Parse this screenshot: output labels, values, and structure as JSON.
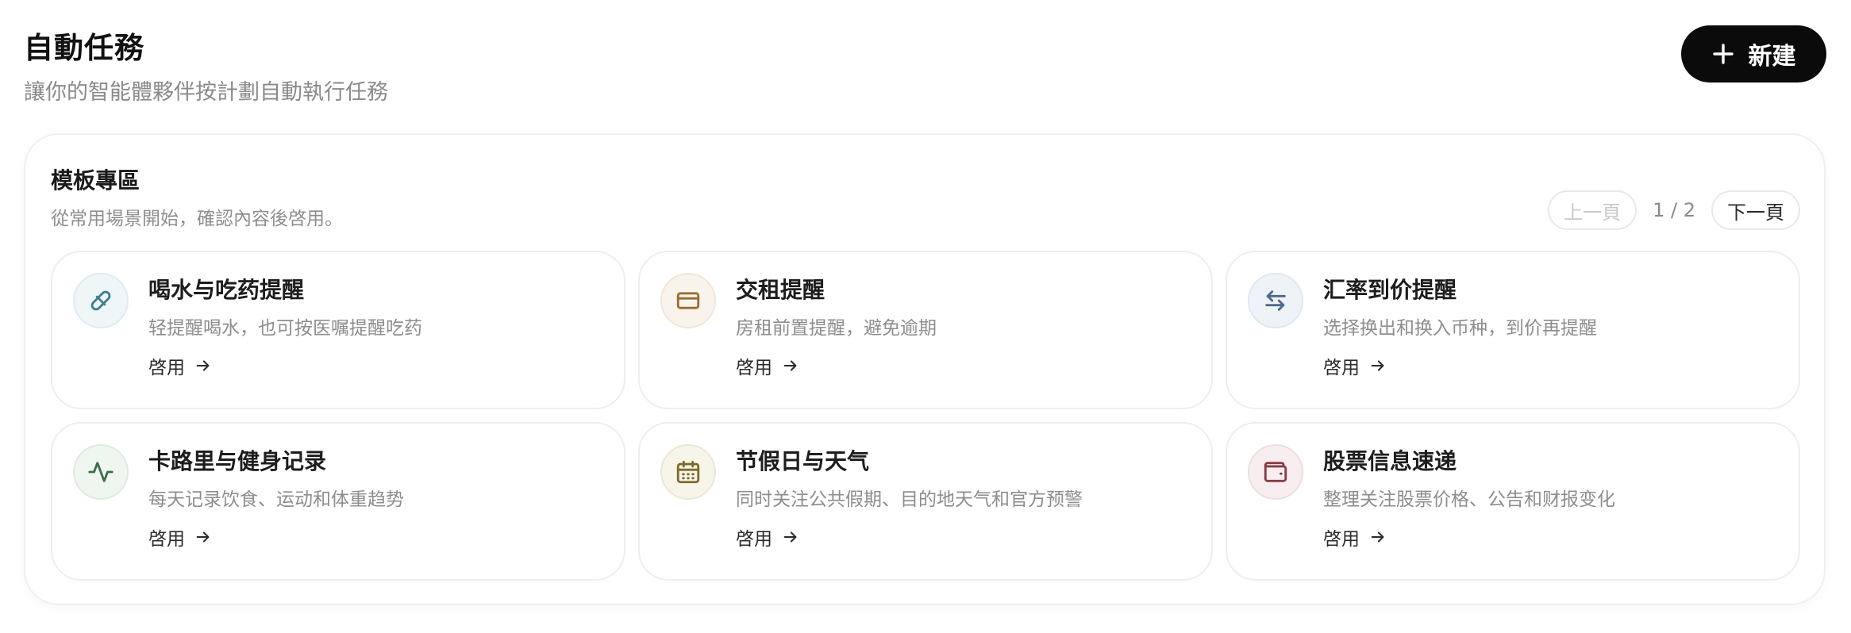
{
  "header": {
    "title": "自動任務",
    "subtitle": "讓你的智能體夥伴按計劃自動執行任務",
    "new_button_label": "新建"
  },
  "templates": {
    "title": "模板專區",
    "subtitle": "從常用場景開始，確認內容後啓用。",
    "pagination": {
      "prev_label": "上一頁",
      "page_indicator": "1 / 2",
      "next_label": "下一頁"
    },
    "cards": [
      {
        "title": "喝水与吃药提醒",
        "description": "轻提醒喝水，也可按医嘱提醒吃药",
        "action_label": "啓用",
        "icon": "pill-icon",
        "icon_bg": "#eef6f8",
        "icon_border": "#dcecef",
        "icon_color": "#3f7f8d"
      },
      {
        "title": "交租提醒",
        "description": "房租前置提醒，避免逾期",
        "action_label": "啓用",
        "icon": "card-icon",
        "icon_bg": "#f8f4ec",
        "icon_border": "#efe7d6",
        "icon_color": "#9a6b2e"
      },
      {
        "title": "汇率到价提醒",
        "description": "选择换出和换入币种，到价再提醒",
        "action_label": "啓用",
        "icon": "exchange-icon",
        "icon_bg": "#eef3f8",
        "icon_border": "#dfe7ef",
        "icon_color": "#4a6b8a"
      },
      {
        "title": "卡路里与健身记录",
        "description": "每天记录饮食、运动和体重趋势",
        "action_label": "啓用",
        "icon": "activity-icon",
        "icon_bg": "#eef6ef",
        "icon_border": "#dcecdd",
        "icon_color": "#3d6e48"
      },
      {
        "title": "节假日与天气",
        "description": "同时关注公共假期、目的地天气和官方预警",
        "action_label": "啓用",
        "icon": "calendar-icon",
        "icon_bg": "#f7f4e9",
        "icon_border": "#ede7d2",
        "icon_color": "#7d6a2a"
      },
      {
        "title": "股票信息速递",
        "description": "整理关注股票价格、公告和财报变化",
        "action_label": "啓用",
        "icon": "wallet-icon",
        "icon_bg": "#f8eeef",
        "icon_border": "#efdde0",
        "icon_color": "#8a3a48"
      }
    ]
  }
}
